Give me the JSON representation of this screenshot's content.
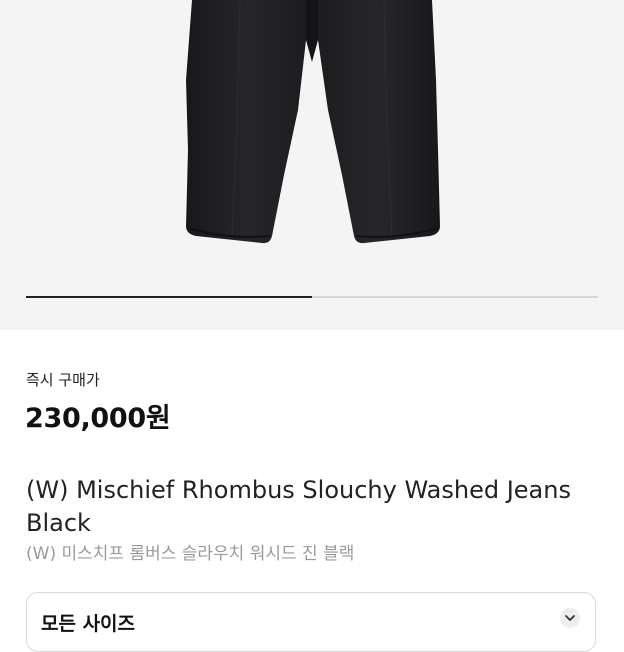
{
  "product": {
    "image_icon": "black-jeans-photo",
    "gallery_progress": 0.5,
    "price_label": "즉시 구매가",
    "price": "230,000원",
    "title": "(W) Mischief Rhombus Slouchy Washed Jeans Black",
    "subtitle": "(W) 미스치프 롬버스 슬라우치 워시드 진 블랙"
  },
  "size_selector": {
    "label": "모든 사이즈",
    "icon": "chevron-down-icon"
  },
  "colors": {
    "image_background": "#f4f4f4",
    "jeans": "#1f1f22",
    "text_primary": "#222222",
    "text_secondary": "#9a9a9a"
  }
}
